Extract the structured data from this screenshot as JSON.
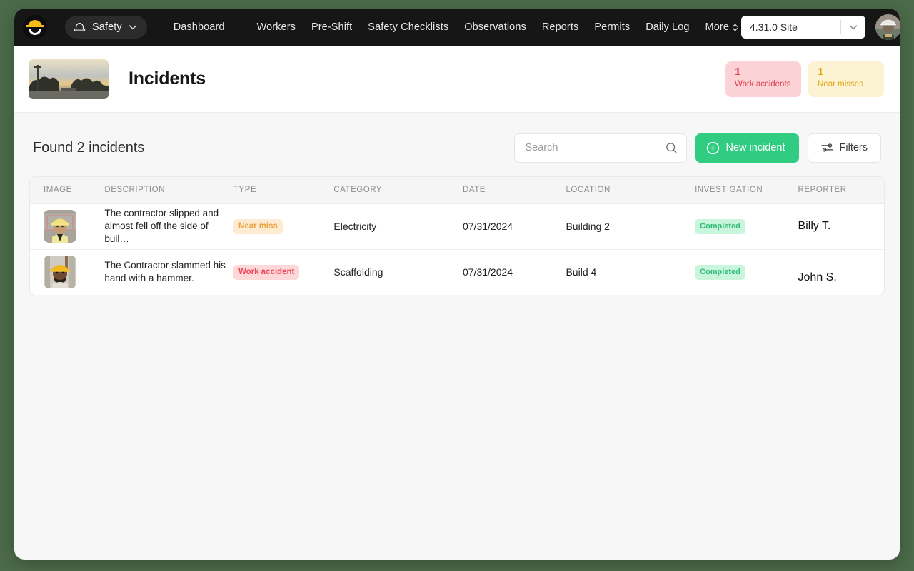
{
  "brand": {
    "logo_name": "hardhat-smile-logo"
  },
  "topnav": {
    "module_label": "Safety",
    "links": [
      "Dashboard",
      "Workers",
      "Pre-Shift",
      "Safety Checklists",
      "Observations",
      "Reports",
      "Permits",
      "Daily Log"
    ],
    "more_label": "More",
    "site_selector_value": "4.31.0 Site"
  },
  "page": {
    "title": "Incidents",
    "stats": [
      {
        "count": "1",
        "label": "Work accidents",
        "color": "#e23b4e",
        "bg": "#fbd3d6"
      },
      {
        "count": "1",
        "label": "Near misses",
        "color": "#e0a418",
        "bg": "#fbf3d2"
      }
    ]
  },
  "toolbar": {
    "found_label": "Found 2 incidents",
    "search_placeholder": "Search",
    "search_value": "",
    "new_incident_label": "New incident",
    "filters_label": "Filters",
    "accent_color": "#2fcc82"
  },
  "table": {
    "columns": [
      "IMAGE",
      "DESCRIPTION",
      "TYPE",
      "CATEGORY",
      "DATE",
      "LOCATION",
      "INVESTIGATION",
      "REPORTER"
    ],
    "rows": [
      {
        "description": "The contractor slipped and almost fell off the side of buil…",
        "type": "Near miss",
        "type_style": "nearmiss",
        "category": "Electricity",
        "date": "07/31/2024",
        "location": "Building 2",
        "investigation": "Completed",
        "reporter": "Billy T."
      },
      {
        "description": "The Contractor slammed his hand with a hammer.",
        "type": "Work accident",
        "type_style": "workacc",
        "category": "Scaffolding",
        "date": "07/31/2024",
        "location": "Build 4",
        "investigation": "Completed",
        "reporter": "John S."
      }
    ]
  }
}
